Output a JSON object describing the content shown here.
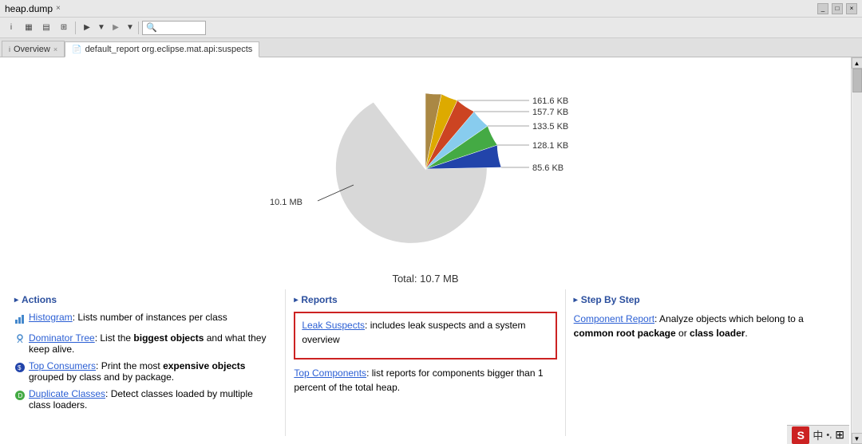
{
  "titlebar": {
    "title": "heap.dump",
    "close_icon": "×"
  },
  "toolbar": {
    "buttons": [
      "i",
      "▦",
      "▤",
      "⊞",
      "▶",
      "▼",
      "▶",
      "▼",
      "🔍"
    ]
  },
  "tabs": [
    {
      "label": "Overview",
      "icon": "i",
      "active": false,
      "closable": true
    },
    {
      "label": "default_report  org.eclipse.mat.api:suspects",
      "icon": "📄",
      "active": true,
      "closable": false
    }
  ],
  "chart": {
    "total_label": "Total: 10.7 MB",
    "large_slice_label": "10.1 MB",
    "labels": [
      {
        "value": "85.6 KB"
      },
      {
        "value": "128.1 KB"
      },
      {
        "value": "133.5 KB"
      },
      {
        "value": "157.7 KB"
      },
      {
        "value": "161.6 KB"
      }
    ]
  },
  "sections": {
    "actions": {
      "title": "Actions",
      "items": [
        {
          "link": "Histogram",
          "text": ": Lists number of instances per class"
        },
        {
          "link": "Dominator Tree",
          "text": ": List the ",
          "bold_text": "biggest objects",
          "text2": " and what they keep alive."
        },
        {
          "link": "Top Consumers",
          "text": ": Print the most ",
          "bold_text": "expensive objects",
          "text2": " grouped by class and by package."
        },
        {
          "link": "Duplicate Classes",
          "text": ": Detect classes loaded by multiple class loaders."
        }
      ]
    },
    "reports": {
      "title": "Reports",
      "leak_suspects": {
        "link": "Leak Suspects",
        "text": ": includes leak suspects and a system overview"
      },
      "top_components": {
        "link": "Top Components",
        "text": ": list reports for components bigger than 1 percent of the total heap."
      }
    },
    "step_by_step": {
      "title": "Step By Step",
      "component_report": {
        "link": "Component Report",
        "text": ": Analyze objects which belong to a ",
        "bold1": "common root package",
        "text2": " or ",
        "bold2": "class loader",
        "text3": "."
      }
    }
  },
  "status_bar": {
    "s_icon": "S",
    "lang_icon": "中",
    "dot_icon": "•,",
    "settings_icon": "⊞"
  }
}
